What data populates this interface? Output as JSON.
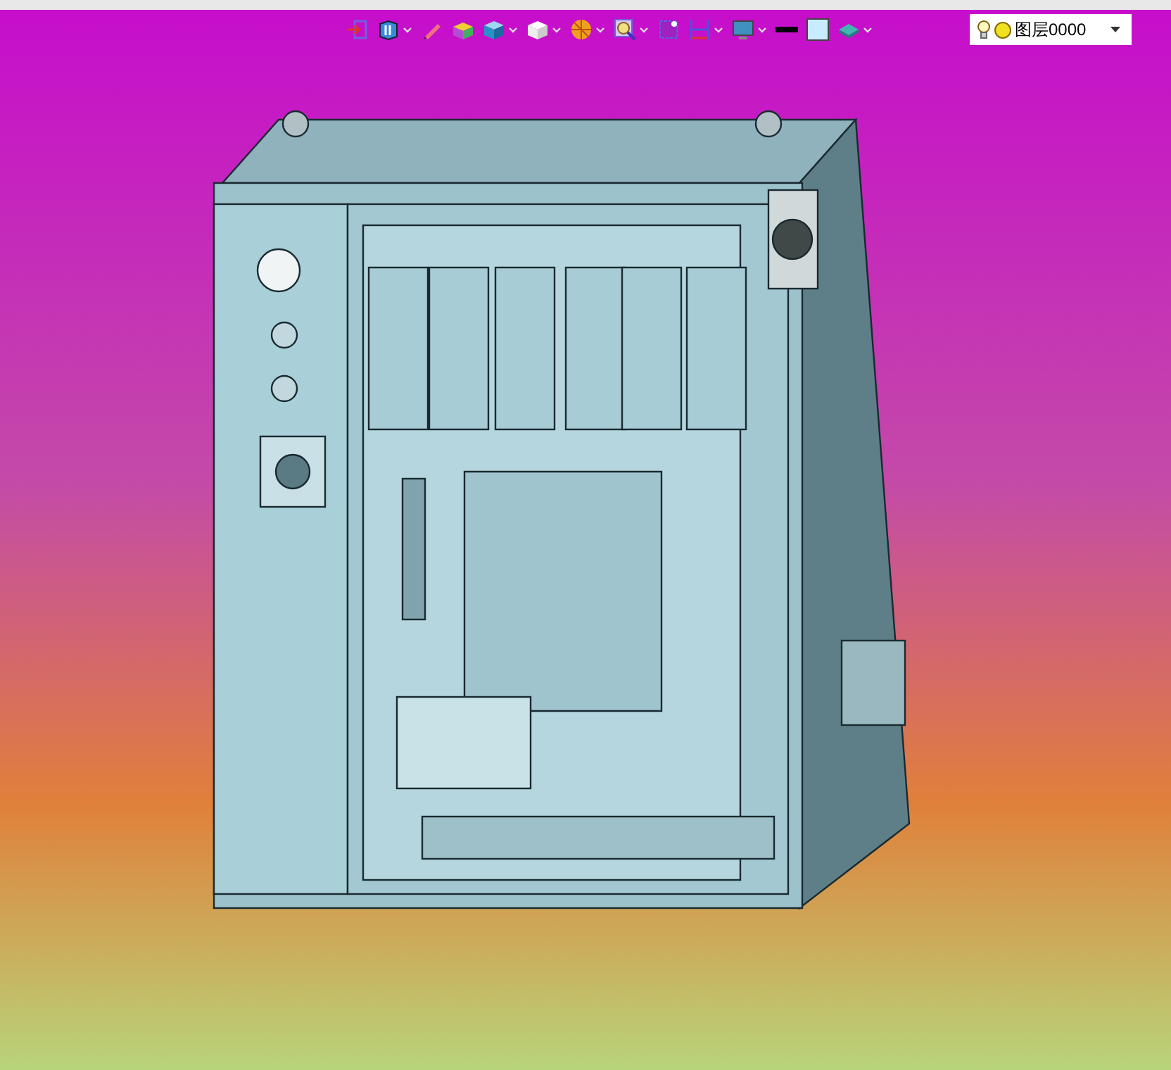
{
  "toolbar": {
    "tools": [
      {
        "kind": "exit",
        "dropdown": false
      },
      {
        "kind": "book",
        "dropdown": true
      },
      {
        "kind": "pencil",
        "dropdown": false
      },
      {
        "kind": "colorbox",
        "dropdown": false
      },
      {
        "kind": "bluecube",
        "dropdown": true
      },
      {
        "kind": "whitecube",
        "dropdown": true
      },
      {
        "kind": "sphere",
        "dropdown": true
      },
      {
        "kind": "zoom",
        "dropdown": true
      },
      {
        "kind": "select",
        "dropdown": false
      },
      {
        "kind": "dimension",
        "dropdown": true
      },
      {
        "kind": "monitor",
        "dropdown": true
      },
      {
        "kind": "linestyle",
        "dropdown": false
      },
      {
        "kind": "fillcolor",
        "dropdown": false
      },
      {
        "kind": "layers",
        "dropdown": true
      }
    ],
    "layer_select": {
      "value": "图层0000",
      "visible": true
    }
  }
}
